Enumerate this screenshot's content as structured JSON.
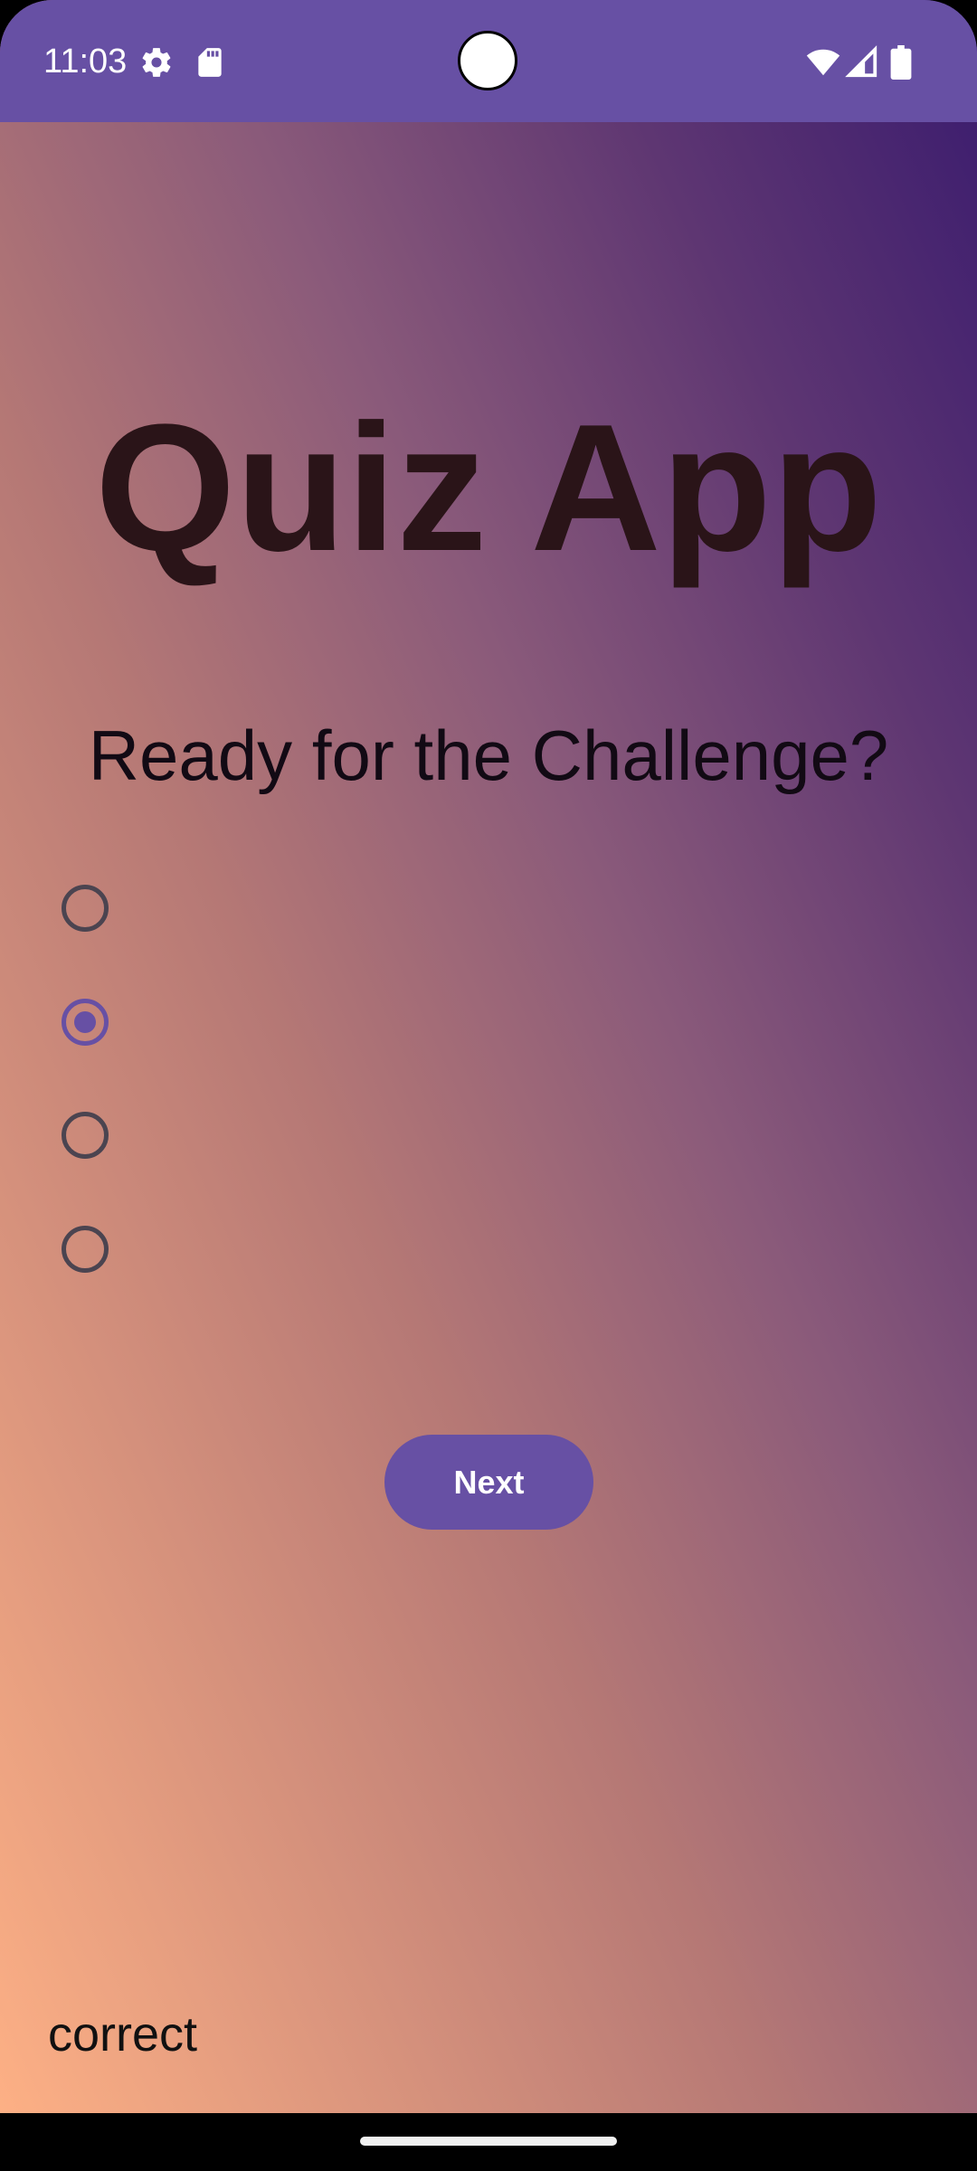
{
  "status_bar": {
    "time": "11:03",
    "icons": [
      "gear-icon",
      "sd-card-icon",
      "wifi-icon",
      "signal-icon",
      "battery-icon"
    ],
    "color": "#6750a4"
  },
  "app": {
    "title": "Quiz App",
    "question": "Ready for the Challenge?",
    "options": [
      {
        "label": "",
        "checked": false
      },
      {
        "label": "",
        "checked": true
      },
      {
        "label": "",
        "checked": false
      },
      {
        "label": "",
        "checked": false
      }
    ],
    "next_label": "Next",
    "result": "correct"
  },
  "colors": {
    "accent": "#6750a4",
    "gradient_start": "#fdb085",
    "gradient_end": "#3a1b6e"
  }
}
